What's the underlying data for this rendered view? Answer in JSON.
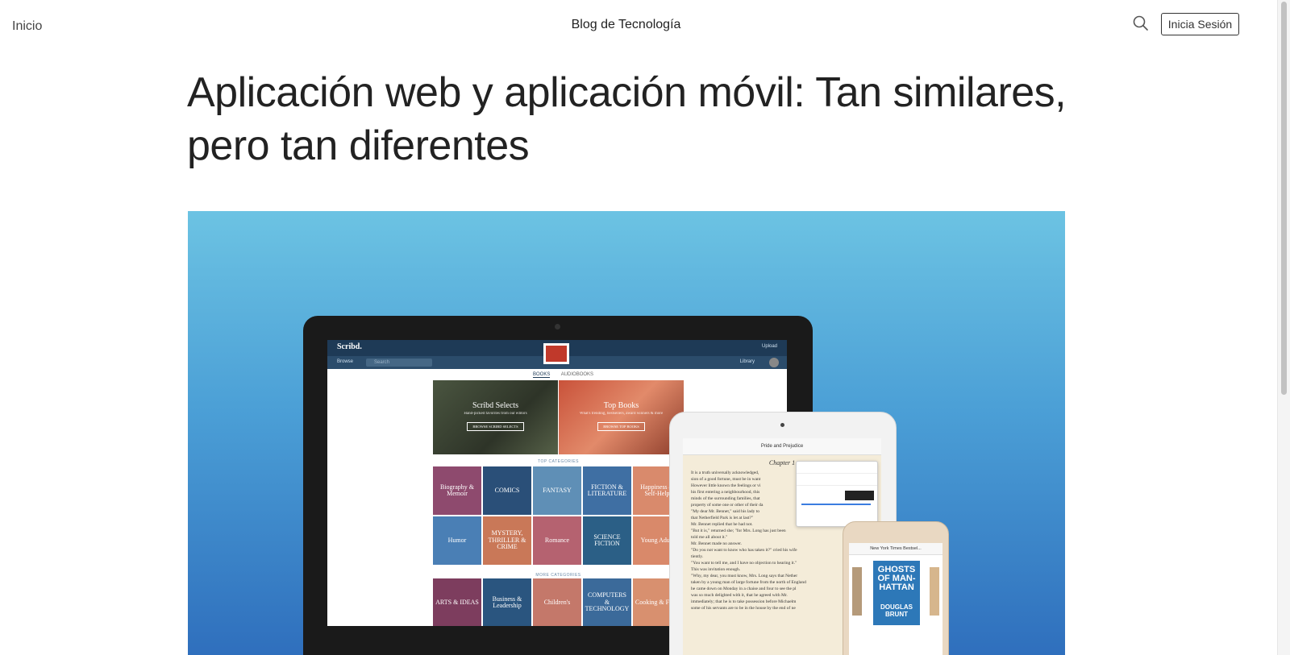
{
  "header": {
    "home_link": "Inicio",
    "site_title": "Blog de Tecnología",
    "search_icon": "search-icon",
    "login_label": "Inicia Sesión"
  },
  "article": {
    "title": "Aplicación web y aplicación móvil: Tan similares, pero tan diferentes"
  },
  "hero": {
    "colors": {
      "top": "#6cc3e3",
      "bottom": "#2f6fbd"
    },
    "laptop": {
      "logo": "Scribd.",
      "upload": "Upload",
      "browse": "Browse",
      "search_placeholder": "Search",
      "library": "Library",
      "tabs": [
        "BOOKS",
        "AUDIOBOOKS"
      ],
      "featured": [
        {
          "title": "Scribd Selects",
          "subtitle": "Hand-picked favorites from our editors",
          "button": "BROWSE SCRIBD SELECTS"
        },
        {
          "title": "Top Books",
          "subtitle": "What's trending, bestsellers, award winners & more",
          "button": "BROWSE TOP BOOKS"
        }
      ],
      "top_categories_label": "TOP CATEGORIES",
      "more_categories_label": "MORE CATEGORIES",
      "top_categories": [
        {
          "label": "Biography & Memoir",
          "color": "#8e4a6e"
        },
        {
          "label": "COMICS",
          "color": "#2a4f78"
        },
        {
          "label": "FANTASY",
          "color": "#5f8fb6"
        },
        {
          "label": "FICTION & LITERATURE",
          "color": "#3f6fa3"
        },
        {
          "label": "Happiness & Self-Help",
          "color": "#d98a6c"
        },
        {
          "label": "Humor",
          "color": "#4a7fb5"
        },
        {
          "label": "MYSTERY, THRILLER & CRIME",
          "color": "#c97858"
        },
        {
          "label": "Romance",
          "color": "#b56270"
        },
        {
          "label": "SCIENCE FICTION",
          "color": "#2b5f86"
        },
        {
          "label": "Young Adult",
          "color": "#d9896a"
        }
      ],
      "more_categories": [
        {
          "label": "ARTS & IDEAS",
          "color": "#7d3d5e"
        },
        {
          "label": "Business & Leadership",
          "color": "#2a557f"
        },
        {
          "label": "Children's",
          "color": "#c4786a"
        },
        {
          "label": "COMPUTERS & TECHNOLOGY",
          "color": "#3b6a9a"
        },
        {
          "label": "Cooking & Food",
          "color": "#d8906f"
        }
      ]
    },
    "tablet": {
      "book_title": "Pride and Prejudice",
      "chapter": "Chapter 1",
      "lines": [
        "It is a truth universally acknowledged,",
        "sion of a good fortune, must be in want",
        "However little known the feelings or vi",
        "his first entering a neighbourhood, this",
        "minds of the surrounding families, that",
        "property of some one or other of their da",
        "\"My dear Mr. Bennet,\" said his lady to",
        "that Netherfield Park is let at last?\"",
        "Mr. Bennet replied that he had not.",
        "\"But it is,\" returned she; \"for Mrs. Long has just been",
        "told me all about it.\"",
        "Mr. Bennet made no answer.",
        "\"Do you not want to know who has taken it?\" cried his wife",
        "tiently.",
        "\"You want to tell me, and I have no objection to hearing it.\"",
        "This was invitation enough.",
        "\"Why, my dear, you must know, Mrs. Long says that Nether",
        "taken by a young man of large fortune from the north of England",
        "he came down on Monday in a chaise and four to see the pl",
        "was so much delighted with it, that he agreed with Mr.",
        "immediately; that he is to take possession before Michaelm",
        "some of his servants are to be in the house by the end of ne"
      ]
    },
    "phone": {
      "list_title": "New York Times Bestsel...",
      "book_title": "GHOSTS OF MAN-HATTAN",
      "book_author": "DOUGLAS BRUNT"
    }
  }
}
